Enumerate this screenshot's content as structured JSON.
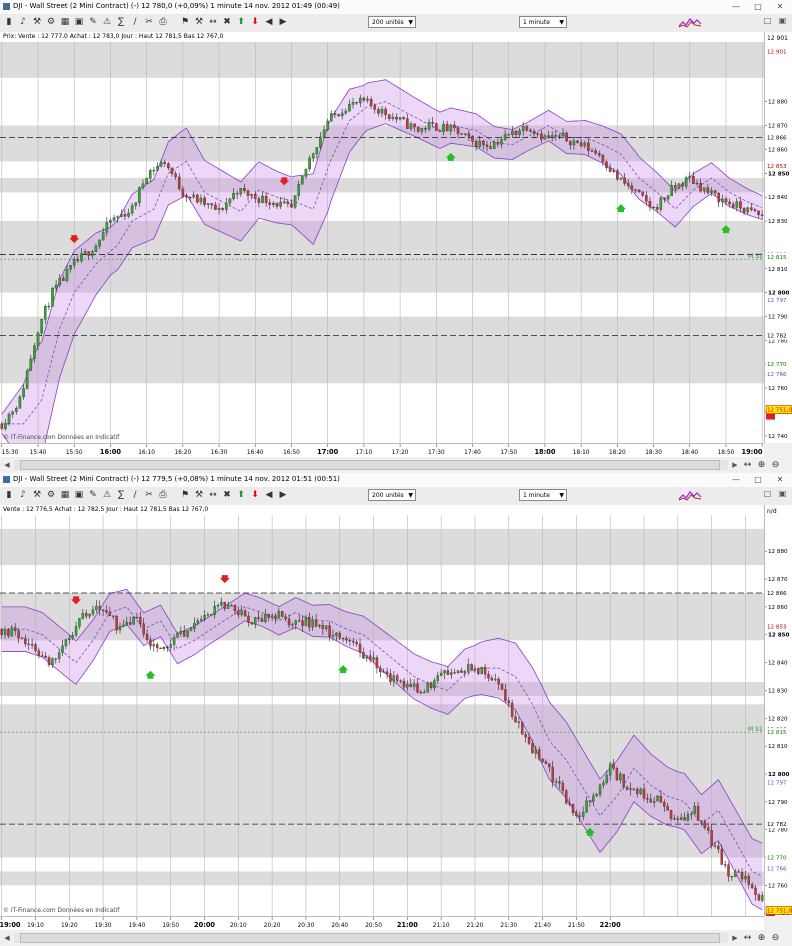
{
  "windows": [
    {
      "title": "DJI - Wall Street (2 Mini Contract) (-)   12 780,0 (+0,09%)   1 minute  14 nov. 2012 01:49 (00:49)",
      "combo_units": "200 unités",
      "combo_interval": "1 minute",
      "info": "Prix: Vente : 12 777,0  Achat : 12 783,0  Jour : Haut 12 781,5  Bas 12 767,0",
      "watermark": "© IT-Finance.com  Données en Indicatif",
      "y_top": "12 901",
      "y_labels": [
        {
          "v": 12880,
          "t": "12 880"
        },
        {
          "v": 12870,
          "t": "12 870"
        },
        {
          "v": 12860,
          "t": "12 860"
        },
        {
          "v": 12850,
          "t": "12 850"
        },
        {
          "v": 12840,
          "t": "12 840"
        },
        {
          "v": 12830,
          "t": "12 830"
        },
        {
          "v": 12810,
          "t": "12 810"
        },
        {
          "v": 12800,
          "t": "12 800"
        },
        {
          "v": 12790,
          "t": "12 790"
        },
        {
          "v": 12780,
          "t": "12 780"
        },
        {
          "v": 12770,
          "t": "12 770"
        },
        {
          "v": 12760,
          "t": "12 760"
        },
        {
          "v": 12750,
          "t": "12 750"
        },
        {
          "v": 12740,
          "t": "12 740"
        }
      ],
      "y_badges": [
        {
          "v": 12901,
          "t": "12 901",
          "c": "#c00000"
        },
        {
          "v": 12865,
          "t": "12 866",
          "c": "#000000"
        },
        {
          "v": 12853,
          "t": "12 853",
          "c": "#c00000"
        },
        {
          "v": 12816,
          "t": "12 816",
          "c": "#000000"
        },
        {
          "v": 12815,
          "t": "12 815",
          "c": "#008000"
        },
        {
          "v": 12797,
          "t": "12 797",
          "c": "#7a3fa0"
        },
        {
          "v": 12782,
          "t": "12 782",
          "c": "#000000"
        },
        {
          "v": 12770,
          "t": "12 770",
          "c": "#008000"
        },
        {
          "v": 12766,
          "t": "12 766",
          "c": "#7a3fa0"
        },
        {
          "v": 12751,
          "t": "12 751,0",
          "c": "#e00000",
          "box": true
        }
      ],
      "ms_label": "M S1",
      "x_labels": [
        "15:30",
        "15:40",
        "15:50",
        "16:00",
        "16:10",
        "16:20",
        "16:30",
        "16:40",
        "16:50",
        "17:00",
        "17:10",
        "17:20",
        "17:30",
        "17:40",
        "17:50",
        "18:00",
        "18:10",
        "18:20",
        "18:30",
        "18:40",
        "18:50",
        "19:00"
      ],
      "x_bold": [
        "16:00",
        "17:00",
        "18:00",
        "19:00"
      ]
    },
    {
      "title": "DJI - Wall Street (2 Mini Contract) (-)   12 779,5 (+0,08%)   1 minute  14 nov. 2012 01:51 (00:51)",
      "combo_units": "200 unités",
      "combo_interval": "1 minute",
      "info": "Vente : 12 776,5  Achat : 12 782,5  Jour : Haut 12 781,5  Bas 12 767,0",
      "watermark": "© IT-Finance.com  Données en Indicatif",
      "y_top": "n/d",
      "y_labels": [
        {
          "v": 12880,
          "t": "12 880"
        },
        {
          "v": 12870,
          "t": "12 870"
        },
        {
          "v": 12860,
          "t": "12 860"
        },
        {
          "v": 12850,
          "t": "12 850"
        },
        {
          "v": 12840,
          "t": "12 840"
        },
        {
          "v": 12830,
          "t": "12 830"
        },
        {
          "v": 12820,
          "t": "12 820"
        },
        {
          "v": 12810,
          "t": "12 810"
        },
        {
          "v": 12800,
          "t": "12 800"
        },
        {
          "v": 12790,
          "t": "12 790"
        },
        {
          "v": 12780,
          "t": "12 780"
        },
        {
          "v": 12770,
          "t": "12 770"
        },
        {
          "v": 12760,
          "t": "12 760"
        },
        {
          "v": 12750,
          "t": "12 750"
        }
      ],
      "y_badges": [
        {
          "v": 12865,
          "t": "12 866",
          "c": "#000000"
        },
        {
          "v": 12853,
          "t": "12 853",
          "c": "#c00000"
        },
        {
          "v": 12816,
          "t": "12 816",
          "c": "#000000"
        },
        {
          "v": 12815,
          "t": "12 815",
          "c": "#008000"
        },
        {
          "v": 12797,
          "t": "12 797",
          "c": "#7a3fa0"
        },
        {
          "v": 12782,
          "t": "12 782",
          "c": "#000000"
        },
        {
          "v": 12770,
          "t": "12 770",
          "c": "#008000"
        },
        {
          "v": 12766,
          "t": "12 766",
          "c": "#7a3fa0"
        },
        {
          "v": 12751,
          "t": "12 751,0",
          "c": "#e00000",
          "box": true
        }
      ],
      "ms_label": "M S1",
      "x_labels": [
        "19:00",
        "19:10",
        "19:20",
        "19:30",
        "19:40",
        "19:50",
        "20:00",
        "20:10",
        "20:20",
        "20:30",
        "20:40",
        "20:50",
        "21:00",
        "21:10",
        "21:20",
        "21:30",
        "21:40",
        "21:50",
        "22:00"
      ],
      "x_bold": [
        "19:00",
        "20:00",
        "21:00",
        "22:00"
      ]
    }
  ],
  "chart_data": [
    {
      "type": "candlestick",
      "interval": "1 minute",
      "x_start": "15:30",
      "x_end": "19:00",
      "ylim": [
        12737,
        12905
      ],
      "close_path": [
        [
          0,
          12745
        ],
        [
          5,
          12755
        ],
        [
          10,
          12785
        ],
        [
          14,
          12800
        ],
        [
          20,
          12812
        ],
        [
          26,
          12820
        ],
        [
          30,
          12830
        ],
        [
          36,
          12835
        ],
        [
          40,
          12850
        ],
        [
          45,
          12855
        ],
        [
          50,
          12842
        ],
        [
          55,
          12838
        ],
        [
          60,
          12834
        ],
        [
          65,
          12843
        ],
        [
          70,
          12840
        ],
        [
          75,
          12838
        ],
        [
          80,
          12835
        ],
        [
          85,
          12856
        ],
        [
          90,
          12872
        ],
        [
          95,
          12878
        ],
        [
          100,
          12880
        ],
        [
          105,
          12876
        ],
        [
          110,
          12872
        ],
        [
          115,
          12868
        ],
        [
          118,
          12870
        ],
        [
          125,
          12868
        ],
        [
          130,
          12863
        ],
        [
          135,
          12862
        ],
        [
          140,
          12866
        ],
        [
          145,
          12870
        ],
        [
          150,
          12865
        ],
        [
          155,
          12865
        ],
        [
          160,
          12862
        ],
        [
          165,
          12858
        ],
        [
          170,
          12848
        ],
        [
          175,
          12842
        ],
        [
          180,
          12835
        ],
        [
          185,
          12843
        ],
        [
          190,
          12848
        ],
        [
          195,
          12842
        ],
        [
          200,
          12838
        ],
        [
          210,
          12832
        ]
      ],
      "band_offset": [
        [
          0,
          4
        ],
        [
          10,
          25
        ],
        [
          30,
          10
        ],
        [
          50,
          14
        ],
        [
          70,
          12
        ],
        [
          80,
          10
        ],
        [
          90,
          18
        ],
        [
          100,
          10
        ],
        [
          115,
          8
        ],
        [
          130,
          7
        ],
        [
          145,
          6
        ],
        [
          160,
          7
        ],
        [
          175,
          9
        ],
        [
          190,
          7
        ],
        [
          210,
          5
        ]
      ],
      "ma_lag": 6,
      "support_levels": [
        12865,
        12816,
        12782
      ],
      "ms1_level": 12814,
      "shaded_bands": [
        [
          12890,
          12905
        ],
        [
          12855,
          12870
        ],
        [
          12842,
          12848
        ],
        [
          12800,
          12830
        ],
        [
          12762,
          12790
        ]
      ],
      "signals": [
        {
          "t": 20,
          "type": "sell"
        },
        {
          "t": 78,
          "type": "sell"
        },
        {
          "t": 124,
          "type": "buy"
        },
        {
          "t": 171,
          "type": "buy"
        },
        {
          "t": 200,
          "type": "buy"
        }
      ]
    },
    {
      "type": "candlestick",
      "interval": "1 minute",
      "x_start": "19:00",
      "x_end": "22:00",
      "ylim": [
        12749,
        12893
      ],
      "close_path": [
        [
          0,
          12852
        ],
        [
          5,
          12850
        ],
        [
          10,
          12845
        ],
        [
          15,
          12840
        ],
        [
          20,
          12848
        ],
        [
          25,
          12858
        ],
        [
          30,
          12860
        ],
        [
          35,
          12852
        ],
        [
          40,
          12855
        ],
        [
          45,
          12845
        ],
        [
          50,
          12848
        ],
        [
          55,
          12852
        ],
        [
          60,
          12856
        ],
        [
          65,
          12860
        ],
        [
          70,
          12858
        ],
        [
          75,
          12855
        ],
        [
          80,
          12858
        ],
        [
          85,
          12855
        ],
        [
          90,
          12855
        ],
        [
          95,
          12852
        ],
        [
          100,
          12850
        ],
        [
          105,
          12845
        ],
        [
          110,
          12840
        ],
        [
          115,
          12835
        ],
        [
          120,
          12832
        ],
        [
          125,
          12830
        ],
        [
          130,
          12836
        ],
        [
          135,
          12838
        ],
        [
          140,
          12838
        ],
        [
          145,
          12835
        ],
        [
          150,
          12825
        ],
        [
          155,
          12812
        ],
        [
          160,
          12805
        ],
        [
          165,
          12795
        ],
        [
          170,
          12785
        ],
        [
          175,
          12792
        ],
        [
          180,
          12802
        ],
        [
          185,
          12796
        ],
        [
          190,
          12792
        ],
        [
          195,
          12790
        ],
        [
          200,
          12782
        ],
        [
          205,
          12787
        ],
        [
          210,
          12776
        ],
        [
          215,
          12765
        ],
        [
          220,
          12762
        ],
        [
          225,
          12755
        ]
      ],
      "band_offset": [
        [
          0,
          8
        ],
        [
          20,
          8
        ],
        [
          40,
          6
        ],
        [
          60,
          5
        ],
        [
          80,
          5
        ],
        [
          100,
          6
        ],
        [
          120,
          8
        ],
        [
          140,
          9
        ],
        [
          160,
          14
        ],
        [
          180,
          13
        ],
        [
          200,
          10
        ],
        [
          225,
          12
        ]
      ],
      "ma_lag": 7,
      "support_levels": [
        12865,
        12782
      ],
      "ms1_level": 12815,
      "shaded_bands": [
        [
          12875,
          12888
        ],
        [
          12848,
          12865
        ],
        [
          12828,
          12833
        ],
        [
          12770,
          12825
        ],
        [
          12760,
          12765
        ]
      ],
      "signals": [
        {
          "t": 22,
          "type": "sell"
        },
        {
          "t": 66,
          "type": "sell"
        },
        {
          "t": 44,
          "type": "buy"
        },
        {
          "t": 101,
          "type": "buy"
        },
        {
          "t": 174,
          "type": "buy"
        }
      ]
    }
  ]
}
